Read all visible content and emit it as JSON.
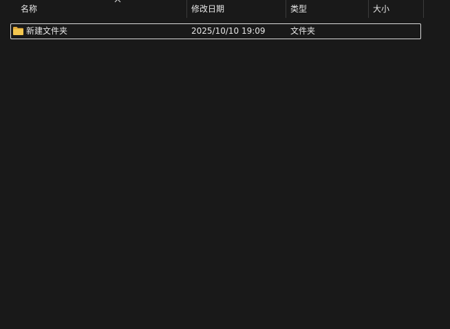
{
  "columns": {
    "name": "名称",
    "modified": "修改日期",
    "type": "类型",
    "size": "大小"
  },
  "sort": {
    "column": "name",
    "direction": "ascending",
    "icon": "chevron-up-icon"
  },
  "items": [
    {
      "icon": "folder-icon",
      "name": "新建文件夹",
      "modified": "2025/10/10 19:09",
      "type": "文件夹",
      "size": ""
    }
  ],
  "colors": {
    "background": "#191919",
    "text": "#e8e8e8",
    "folder": "#f4c74f",
    "selection_border": "#dcdcdc"
  }
}
